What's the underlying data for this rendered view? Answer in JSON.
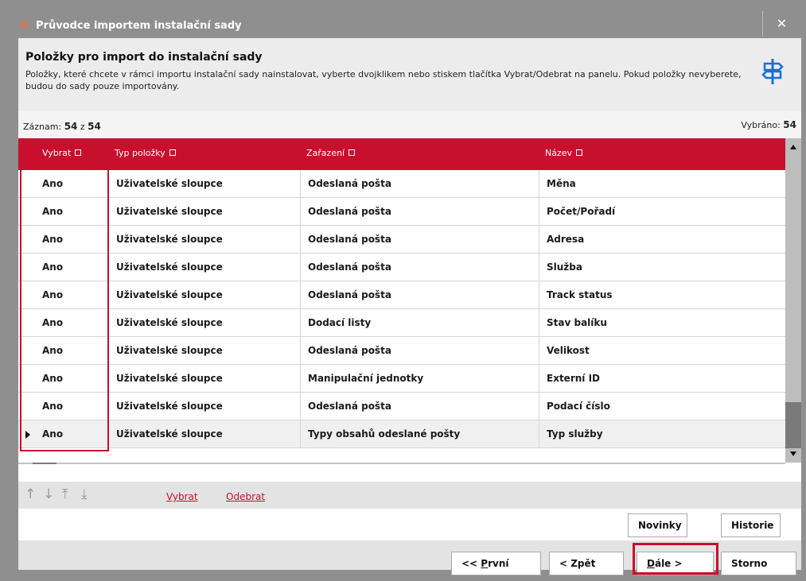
{
  "window": {
    "title": "Průvodce importem instalační sady",
    "close_label": "✕"
  },
  "header": {
    "title": "Položky pro import do instalační sady",
    "description": "Položky, které chcete v rámci importu instalační sady nainstalovat, vyberte dvojklikem nebo stiskem tlačítka Vybrat/Odebrat na panelu. Pokud položky nevyberete, budou do sady pouze importovány."
  },
  "records": {
    "left_label": "Záznam:",
    "current": "54",
    "of": "z",
    "total": "54",
    "selected_label": "Vybráno:",
    "selected": "54"
  },
  "grid": {
    "columns": [
      "Vybrat",
      "Typ položky",
      "Zařazení",
      "Název"
    ],
    "rows": [
      {
        "select": "Ano",
        "type": "Uživatelské sloupce",
        "category": "Odeslaná pošta",
        "name": "Měna"
      },
      {
        "select": "Ano",
        "type": "Uživatelské sloupce",
        "category": "Odeslaná pošta",
        "name": "Počet/Pořadí"
      },
      {
        "select": "Ano",
        "type": "Uživatelské sloupce",
        "category": "Odeslaná pošta",
        "name": "Adresa"
      },
      {
        "select": "Ano",
        "type": "Uživatelské sloupce",
        "category": "Odeslaná pošta",
        "name": "Služba"
      },
      {
        "select": "Ano",
        "type": "Uživatelské sloupce",
        "category": "Odeslaná pošta",
        "name": "Track status"
      },
      {
        "select": "Ano",
        "type": "Uživatelské sloupce",
        "category": "Dodací listy",
        "name": "Stav balíku"
      },
      {
        "select": "Ano",
        "type": "Uživatelské sloupce",
        "category": "Odeslaná pošta",
        "name": "Velikost"
      },
      {
        "select": "Ano",
        "type": "Uživatelské sloupce",
        "category": "Manipulační jednotky",
        "name": "Externí ID"
      },
      {
        "select": "Ano",
        "type": "Uživatelské sloupce",
        "category": "Odeslaná pošta",
        "name": "Podací číslo"
      },
      {
        "select": "Ano",
        "type": "Uživatelské sloupce",
        "category": "Typy obsahů odeslané pošty",
        "name": "Typ služby"
      }
    ]
  },
  "navbar": {
    "icons": [
      "arrow-up-icon",
      "arrow-down-icon",
      "arrow-to-top-icon",
      "arrow-to-bottom-icon"
    ],
    "select_link": "Vybrat",
    "remove_link": "Odebrat"
  },
  "buttons": {
    "news": "Novinky",
    "history": "Historie",
    "first_prefix": "<< ",
    "first_key": "P",
    "first_rest": "rvní",
    "back": "< Zpět",
    "next_key": "D",
    "next_rest": "ále >",
    "cancel": "Storno"
  },
  "colors": {
    "accent": "#c8102e",
    "frame": "#8f8f8f"
  }
}
